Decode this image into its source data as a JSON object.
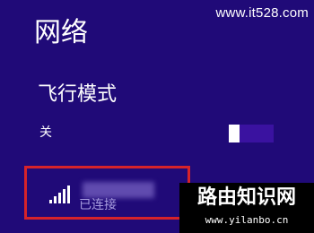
{
  "watermark": {
    "top_url": "www.it528.com",
    "brand_title": "路由知识网",
    "brand_url": "www.yilanbo.cn"
  },
  "panel": {
    "title": "网络"
  },
  "airplane_mode": {
    "title": "飞行模式",
    "state_label": "关",
    "toggle_on": false
  },
  "network": {
    "status": "已连接",
    "icon": "wifi-signal-icon",
    "signal_bars": 5
  },
  "colors": {
    "background": "#200a78",
    "highlight_border": "#d6232a",
    "status_text": "#a89de0"
  }
}
